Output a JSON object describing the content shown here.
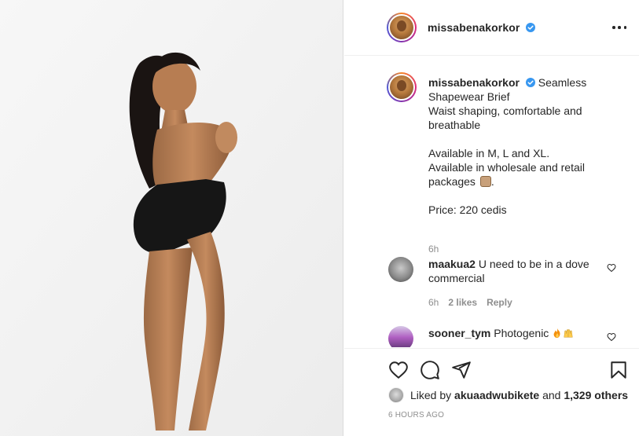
{
  "post": {
    "username": "missabenakorkor",
    "verified": true
  },
  "caption": {
    "username": "missabenakorkor",
    "lines": [
      "Seamless",
      "Shapewear Brief",
      "Waist shaping, comfortable and",
      "breathable",
      "",
      "Available in M, L and XL.",
      "Available in wholesale and retail",
      "packages",
      "",
      "Price: 220 cedis"
    ],
    "period": ".",
    "time": "6h"
  },
  "comments": [
    {
      "username": "maakua2",
      "text_line1": "U need to be in a dove",
      "text_line2": "commercial",
      "time": "6h",
      "likes": "2 likes",
      "reply": "Reply"
    },
    {
      "username": "sooner_tym",
      "text": "Photogenic"
    }
  ],
  "likes": {
    "prefix": "Liked by",
    "user": "akuaadwubikete",
    "conjunction": "and",
    "others": "1,329 others"
  },
  "timestamp": "6 HOURS AGO",
  "colors": {
    "verified": "#3897f0",
    "text": "#262626",
    "muted": "#8e8e8e",
    "border": "#dbdbdb"
  },
  "icons": {
    "more": "more-options-icon",
    "like": "heart-icon",
    "comment": "comment-bubble-icon",
    "share": "paper-plane-icon",
    "save": "bookmark-icon"
  }
}
